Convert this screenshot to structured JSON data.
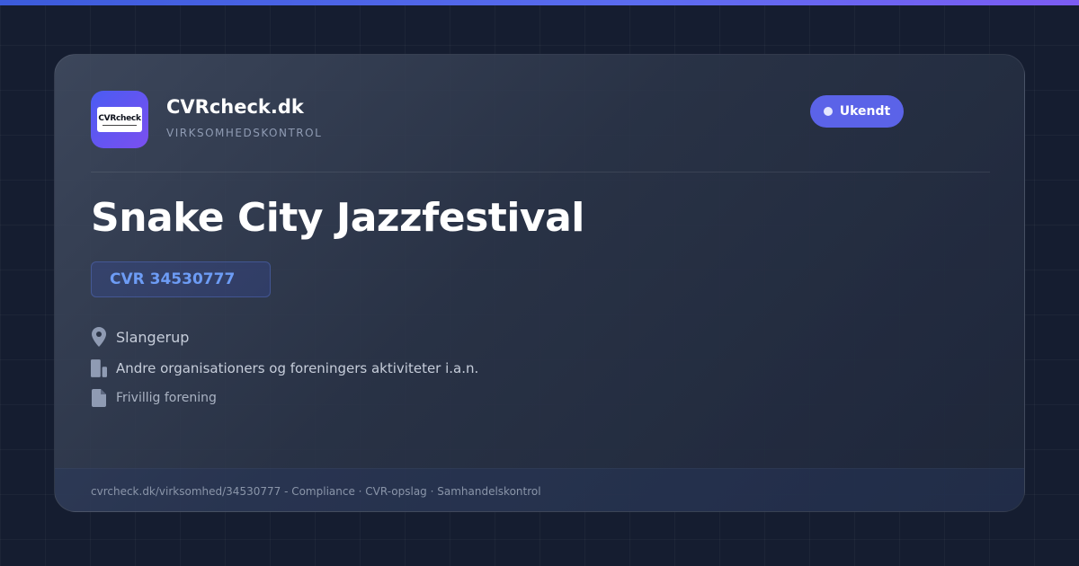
{
  "brand": {
    "logo_text": "CVRcheck",
    "name": "CVRcheck.dk",
    "tagline": "VIRKSOMHEDSKONTROL"
  },
  "status": {
    "label": "Ukendt"
  },
  "company": {
    "name": "Snake City Jazzfestival",
    "cvr": "CVR 34530777",
    "location": "Slangerup",
    "industry": "Andre organisationers og foreningers aktiviteter i.a.n.",
    "legal_form": "Frivillig forening"
  },
  "footer": {
    "text": "cvrcheck.dk/virksomhed/34530777 - Compliance · CVR-opslag · Samhandelskontrol"
  },
  "icons": {
    "location": "map-pin-icon",
    "industry": "building-icon",
    "legal_form": "document-icon"
  },
  "colors": {
    "accent": "#5b63e8",
    "cvr_text": "#6d9cf5",
    "background": "#151d30"
  }
}
